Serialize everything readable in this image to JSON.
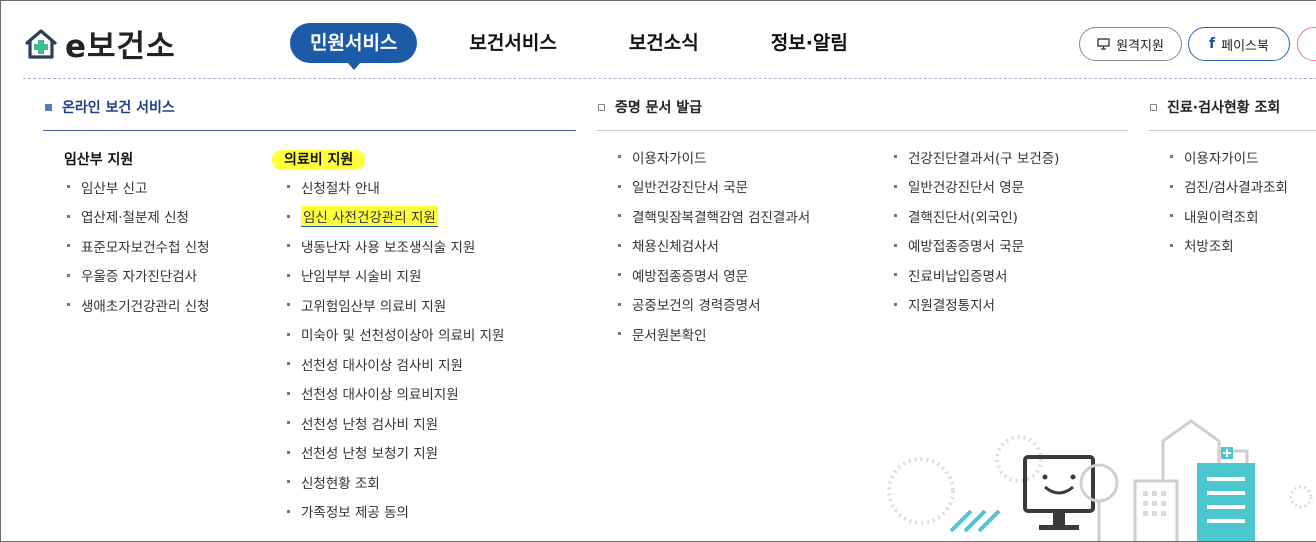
{
  "header": {
    "logo_text": "e보건소",
    "nav": [
      {
        "label": "민원서비스",
        "active": true
      },
      {
        "label": "보건서비스",
        "active": false
      },
      {
        "label": "보건소식",
        "active": false
      },
      {
        "label": "정보·알림",
        "active": false
      }
    ],
    "remote_support_label": "원격지원",
    "facebook_label": "페이스북"
  },
  "colors": {
    "primary": "#1c5ba8",
    "highlight": "#ffff3b",
    "accent_teal": "#4cc6cf"
  },
  "sections": {
    "online": {
      "title": "온라인 보건 서비스",
      "pregnancy": {
        "heading": "임산부 지원",
        "items": [
          "임산부 신고",
          "엽산제·철분제 신청",
          "표준모자보건수첩 신청",
          "우울증 자가진단검사",
          "생애초기건강관리 신청"
        ]
      },
      "medical": {
        "heading": "의료비 지원",
        "items": [
          "신청절차 안내",
          "임신 사전건강관리 지원",
          "냉동난자 사용 보조생식술 지원",
          "난임부부 시술비 지원",
          "고위험임산부 의료비 지원",
          "미숙아 및 선천성이상아 의료비 지원",
          "선천성 대사이상 검사비 지원",
          "선천성 대사이상 의료비지원",
          "선천성 난청 검사비 지원",
          "선천성 난청 보청기 지원",
          "신청현황 조회",
          "가족정보 제공 동의"
        ]
      }
    },
    "certificate": {
      "title": "증명 문서 발급",
      "col1": [
        "이용자가이드",
        "일반건강진단서 국문",
        "결핵및잠복결핵감염 검진결과서",
        "채용신체검사서",
        "예방접종증명서 영문",
        "공중보건의 경력증명서",
        "문서원본확인"
      ],
      "col2": [
        "건강진단결과서(구 보건증)",
        "일반건강진단서 영문",
        "결핵진단서(외국인)",
        "예방접종증명서 국문",
        "진료비납입증명서",
        "지원결정통지서"
      ]
    },
    "exam": {
      "title": "진료·검사현황 조회",
      "items": [
        "이용자가이드",
        "검진/검사결과조회",
        "내원이력조회",
        "처방조회"
      ]
    }
  }
}
